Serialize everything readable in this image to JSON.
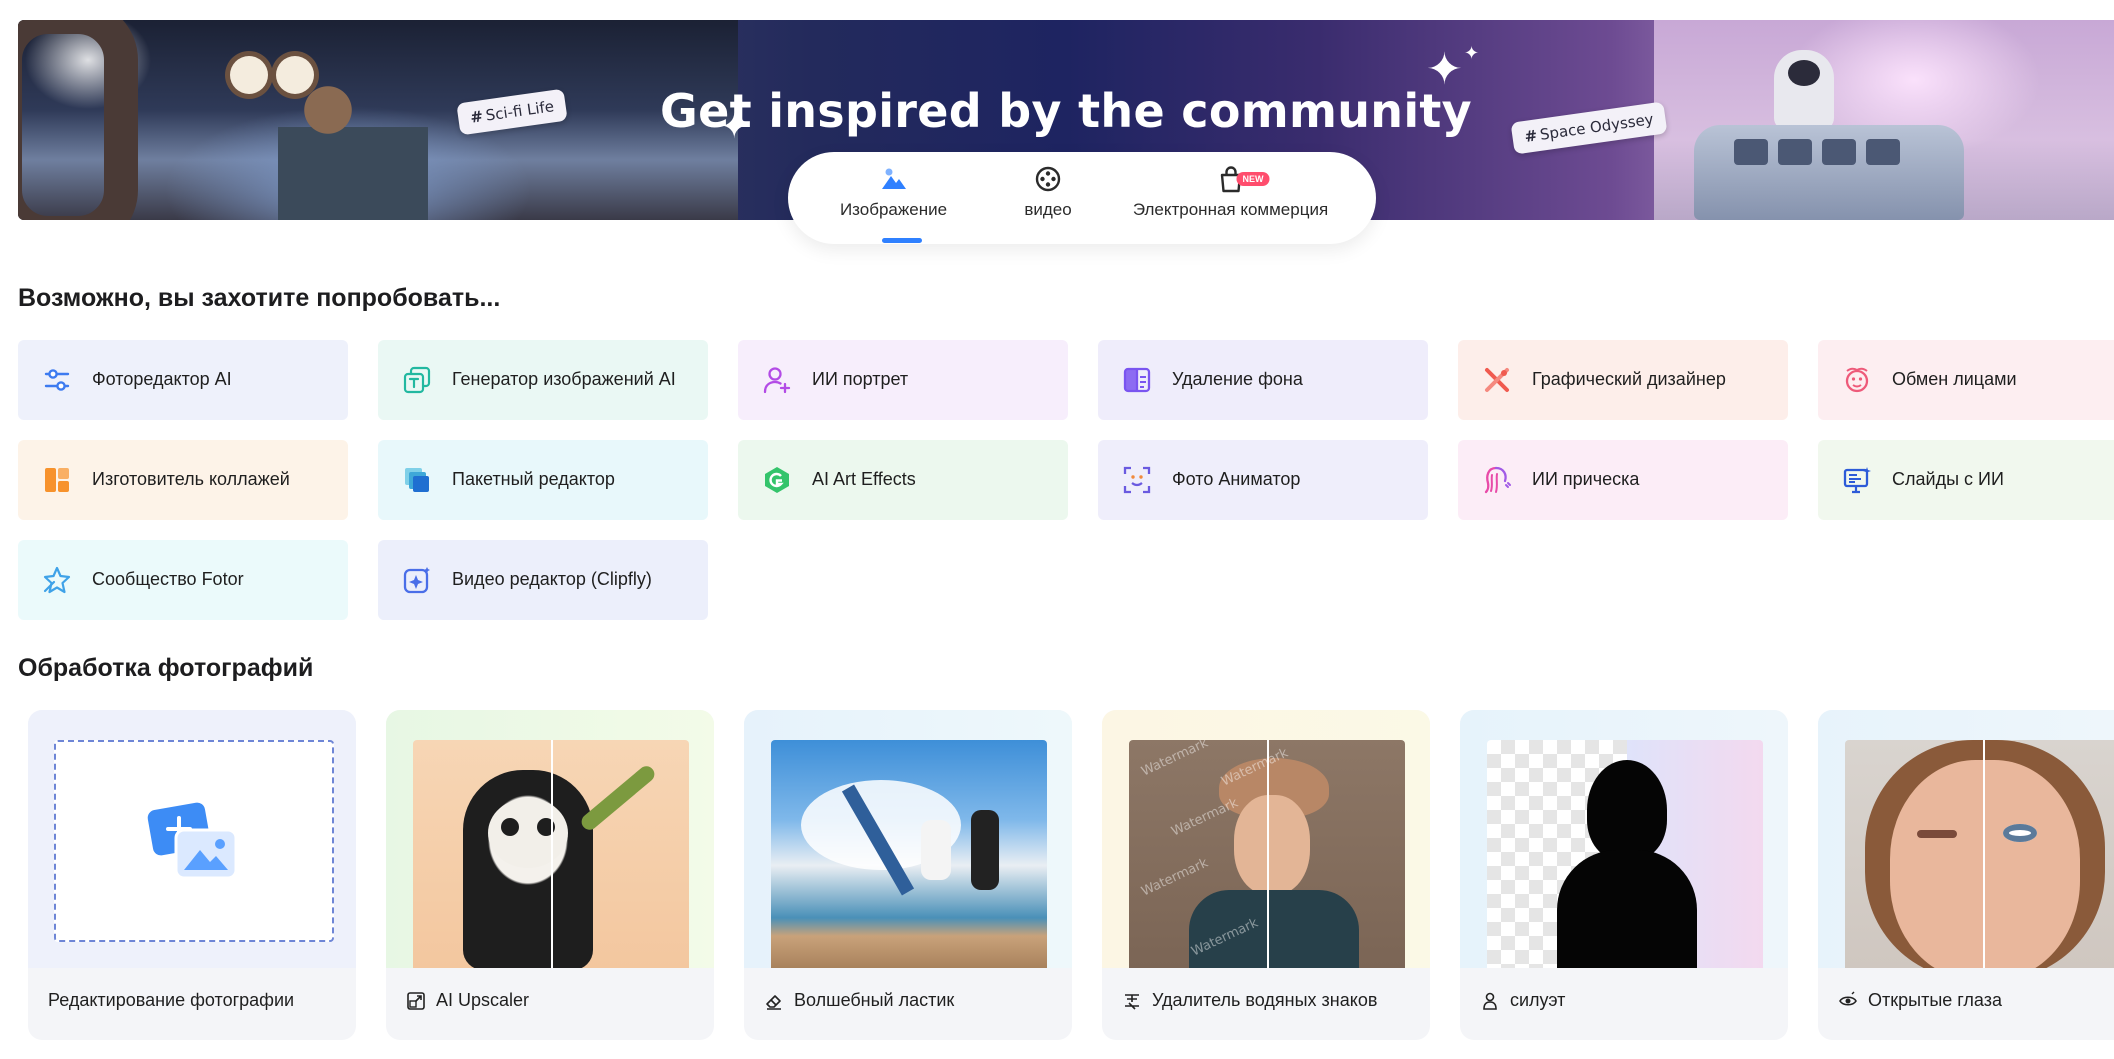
{
  "banner": {
    "title": "Get inspired by the community",
    "tag_left": "Sci-fi Life",
    "tag_right": "Space Odyssey",
    "hash": "#"
  },
  "tabs": {
    "items": [
      {
        "label": "Изображение",
        "icon": "image-mountain-icon",
        "active": true
      },
      {
        "label": "видео",
        "icon": "film-reel-icon"
      },
      {
        "label": "Электронная коммерция",
        "icon": "shopping-bag-icon",
        "badge": "NEW"
      }
    ],
    "accent": "#2f80ff"
  },
  "suggest": {
    "title": "Возможно, вы захотите попробовать...",
    "tools": [
      {
        "label": "Фоторедактор AI",
        "icon": "sliders-icon",
        "bg": "#eef1fb"
      },
      {
        "label": "Генератор изображений AI",
        "icon": "text-to-image-icon",
        "bg": "#eaf8f4"
      },
      {
        "label": "ИИ портрет",
        "icon": "portrait-plus-icon",
        "bg": "#f7eefc"
      },
      {
        "label": "Удаление фона",
        "icon": "background-remove-icon",
        "bg": "#efedfb"
      },
      {
        "label": "Графический дизайнер",
        "icon": "design-tools-icon",
        "bg": "#fdeeea"
      },
      {
        "label": "Обмен лицами",
        "icon": "face-swap-icon",
        "bg": "#fdeef1"
      },
      {
        "label": "Изготовитель коллажей",
        "icon": "collage-icon",
        "bg": "#fdf3e8"
      },
      {
        "label": "Пакетный редактор",
        "icon": "batch-layers-icon",
        "bg": "#e8f8fb"
      },
      {
        "label": "AI Art Effects",
        "icon": "art-effects-icon",
        "bg": "#ecf8ee"
      },
      {
        "label": "Фото Аниматор",
        "icon": "face-animate-icon",
        "bg": "#efeefb"
      },
      {
        "label": "ИИ прическа",
        "icon": "hairstyle-icon",
        "bg": "#fcedf7"
      },
      {
        "label": "Слайды с ИИ",
        "icon": "slides-icon",
        "bg": "#f1f8ee"
      },
      {
        "label": "Сообщество Fotor",
        "icon": "community-star-icon",
        "bg": "#ebfafb"
      },
      {
        "label": "Видео редактор (Clipfly)",
        "icon": "video-editor-icon",
        "bg": "#eceffb"
      }
    ]
  },
  "photo": {
    "title": "Обработка фотографий",
    "cards": [
      {
        "caption": "Редактирование фотографии",
        "icon": ""
      },
      {
        "caption": "AI Upscaler",
        "icon": "upscale-icon"
      },
      {
        "caption": "Волшебный ластик",
        "icon": "eraser-icon"
      },
      {
        "caption": "Удалитель водяных знаков",
        "icon": "watermark-remove-icon"
      },
      {
        "caption": "силуэт",
        "icon": "silhouette-icon"
      },
      {
        "caption": "Открытые глаза",
        "icon": "open-eye-icon"
      }
    ],
    "watermark_text": "Watermark"
  }
}
